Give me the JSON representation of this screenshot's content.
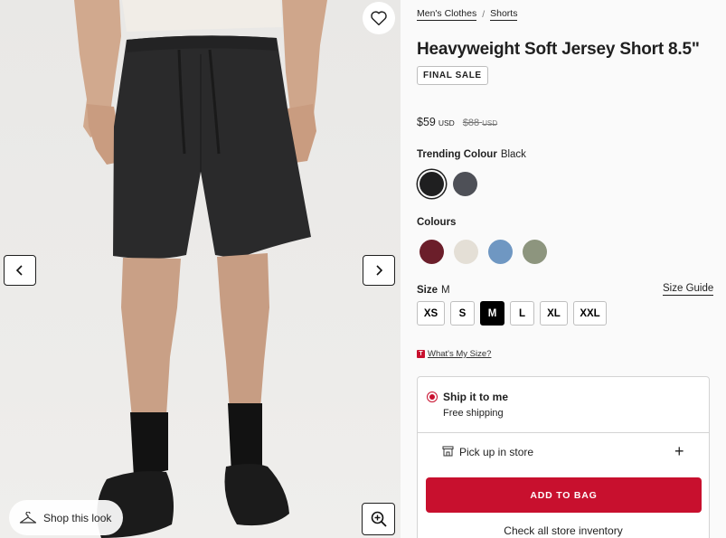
{
  "gallery": {
    "shop_look_label": "Shop this look",
    "icons": {
      "favorite": "heart-icon",
      "prev": "chevron-left-icon",
      "next": "chevron-right-icon",
      "shop_look": "hanger-icon",
      "zoom": "zoom-in-icon"
    }
  },
  "breadcrumb": {
    "items": [
      "Men's Clothes",
      "Shorts"
    ],
    "separator": "/"
  },
  "product": {
    "title": "Heavyweight Soft Jersey Short 8.5\"",
    "badge": "FINAL SALE",
    "price": {
      "current": "$59",
      "current_currency": "USD",
      "original": "$88",
      "original_currency": "USD"
    }
  },
  "trending": {
    "label": "Trending Colour",
    "value": "Black",
    "swatches": [
      {
        "name": "Black",
        "color": "#1f1f20",
        "selected": true
      },
      {
        "name": "Charcoal",
        "color": "#4e5057",
        "selected": false
      }
    ]
  },
  "colours": {
    "label": "Colours",
    "swatches": [
      {
        "color": "#6b1e2a"
      },
      {
        "color": "#e4dfd6"
      },
      {
        "color": "#6f97c2"
      },
      {
        "color": "#8d957e"
      }
    ]
  },
  "size": {
    "label": "Size",
    "value": "M",
    "guide_label": "Size Guide",
    "options": [
      "XS",
      "S",
      "M",
      "L",
      "XL",
      "XXL"
    ],
    "selected": "M",
    "whats_my_size": "What's My Size?",
    "whats_my_size_icon": "T"
  },
  "fulfillment": {
    "ship_title": "Ship it to me",
    "ship_subtitle": "Free shipping",
    "pickup_label": "Pick up in store",
    "expand_symbol": "+",
    "add_to_bag": "ADD TO BAG",
    "store_inventory": "Check all store inventory"
  },
  "colors": {
    "accent": "#c8102e",
    "text": "#1f1f1f",
    "panel_bg": "#fafafa"
  }
}
